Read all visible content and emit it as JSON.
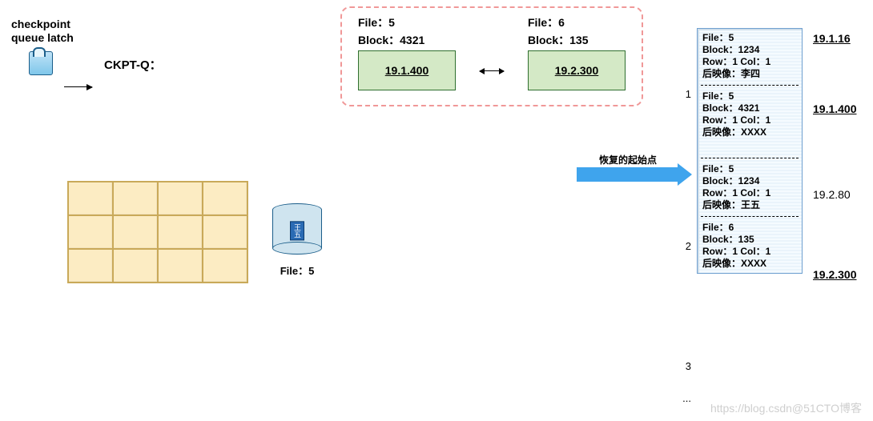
{
  "checkpoint": {
    "title_line1": "checkpoint",
    "title_line2": "queue latch",
    "label": "CKPT-Q："
  },
  "ckpt_nodes": [
    {
      "file_label": "File：5",
      "block_label": "Block：4321",
      "scn": "19.1.400"
    },
    {
      "file_label": "File：6",
      "block_label": "Block：135",
      "scn": "19.2.300"
    }
  ],
  "db": {
    "caption": "File：5",
    "chip_text": "王五"
  },
  "arrow_label": "恢复的起始点",
  "log": {
    "groups": [
      {
        "num": "1",
        "entries": [
          {
            "file": "File：5",
            "block": "Block：1234",
            "row": "Row：1 Col：1",
            "image": "后映像：李四",
            "scn": "19.1.16",
            "scn_bold": true
          },
          {
            "file": "File：5",
            "block": "Block：4321",
            "row": "Row：1 Col：1",
            "image": "后映像：XXXX",
            "scn": "19.1.400",
            "scn_bold": true
          }
        ]
      },
      {
        "num": "2",
        "entries": [
          {
            "file": "File：5",
            "block": "Block：1234",
            "row": "Row：1 Col：1",
            "image": "后映像：王五",
            "scn": "19.2.80",
            "scn_bold": false
          },
          {
            "file": "File：6",
            "block": "Block：135",
            "row": "Row：1 Col：1",
            "image": "后映像：XXXX",
            "scn": "19.2.300",
            "scn_bold": true
          }
        ]
      }
    ],
    "tail_items": [
      "3",
      "..."
    ]
  },
  "watermark": "https://blog.csdn@51CTO博客"
}
